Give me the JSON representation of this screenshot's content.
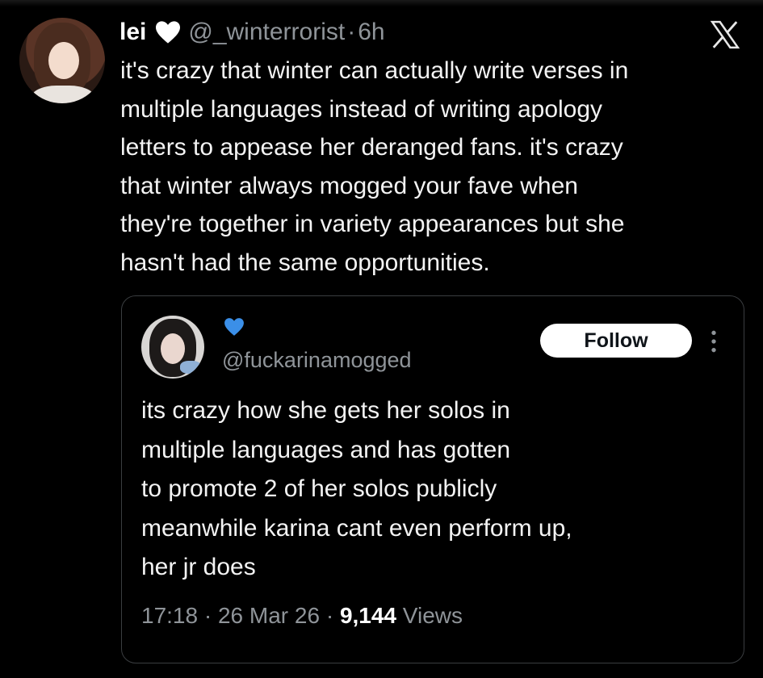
{
  "tweet": {
    "display_name": "lei",
    "handle": "@_winterrorist",
    "separator": "·",
    "age": "6h",
    "text_lines": [
      "it's crazy that winter can actually write verses in",
      "multiple languages instead of writing apology",
      "letters to appease her deranged fans. it's crazy",
      "that winter always mogged your fave when",
      "they're together in variety appearances but she",
      "hasn't had the same opportunities."
    ]
  },
  "quote": {
    "handle": "@fuckarinamogged",
    "follow_label": "Follow",
    "text_lines": [
      "its crazy how she gets her solos in",
      "multiple languages and has gotten",
      "to promote 2 of her solos publicly",
      "meanwhile karina cant even perform up,",
      "her jr does"
    ],
    "time": "17:18",
    "date": "26 Mar 26",
    "separator": "·",
    "views_count": "9,144",
    "views_label": "Views"
  },
  "icons": {
    "heart": "white-heart-icon",
    "verified_heart": "blue-heart-icon",
    "brand": "x-logo-icon",
    "more": "more-vertical-icon"
  },
  "colors": {
    "background": "#000000",
    "text": "#f3f3f3",
    "muted": "#8f9499",
    "card_border": "#3a3d40",
    "blue_heart": "#3b8fe8"
  }
}
